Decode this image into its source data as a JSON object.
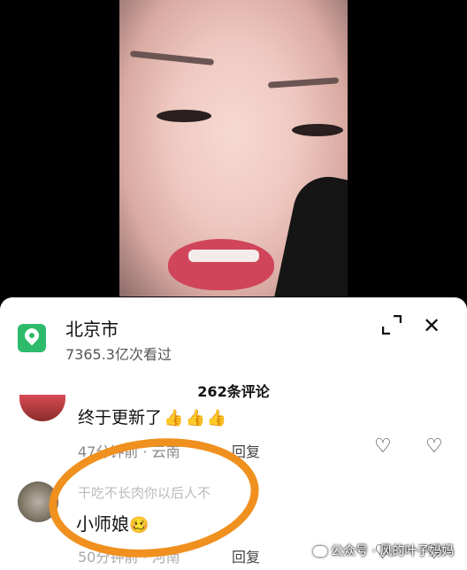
{
  "location": {
    "title": "北京市",
    "views": "7365.3亿次看过",
    "expand_icon": "expand-icon",
    "close_icon": "close-icon",
    "close_glyph": "✕"
  },
  "comments_header": "262条评论",
  "comments": [
    {
      "text": "终于更新了",
      "emojis": [
        "👍",
        "👍",
        "👍"
      ],
      "meta": "47分钟前 · 云南",
      "reply": "回复"
    },
    {
      "user": "干吃不长肉你以后人不",
      "text": "小师娘",
      "emoji": "🥴",
      "meta": "50分钟前 · 河南",
      "reply": "回复"
    }
  ],
  "icons": {
    "like": "♡",
    "dislike": "♡"
  },
  "colors": {
    "accent_green": "#2dbb6b",
    "highlight_orange": "#f0901e"
  },
  "watermark": "公众号 · 风的叶子妈妈"
}
